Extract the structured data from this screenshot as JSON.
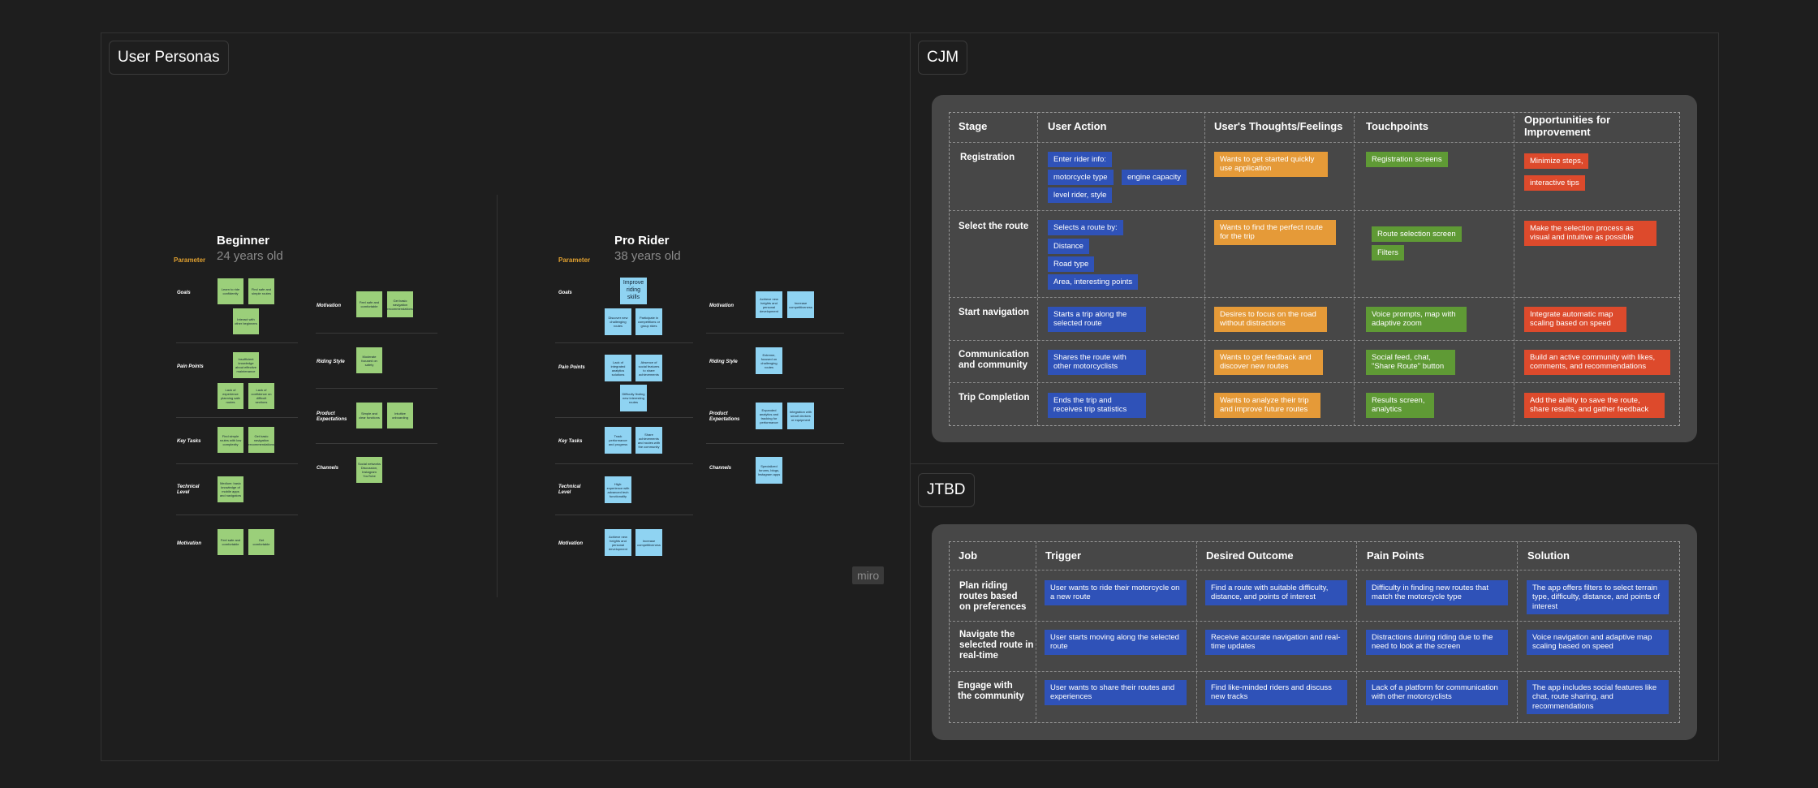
{
  "frames": {
    "personas": "User Personas",
    "cjm": "CJM",
    "jtbd": "JTBD"
  },
  "watermark": "miro",
  "personas": {
    "beginner": {
      "title": "Beginner",
      "age": "24 years old",
      "param": "Parameter",
      "rows": [
        "Goals",
        "Pain Points",
        "Key Tasks",
        "Technical Level",
        "Motivation"
      ],
      "right_rows": [
        "Motivation",
        "Riding Style",
        "Product Expectations",
        "Channels"
      ],
      "goals": [
        "Learn to ride confidently",
        "Find safe and simple routes",
        "Interact with other beginners"
      ],
      "pain": [
        "Insufficient knowledge about effective maintenance",
        "Lack of experience planning safe routes",
        "Lack of confidence on difficult sections"
      ],
      "tasks": [
        "Find simple routes with low complexity",
        "Get basic navigation recommendations"
      ],
      "tech": [
        "Medium: basic knowledge of mobile apps and navigators"
      ],
      "motiv": [
        "Feel safe and comfortable",
        "Get comfortable"
      ],
      "r_motiv": [
        "Feel safe and comfortable",
        "Get basic navigation recommendations"
      ],
      "r_style": [
        "Moderate focused on safety"
      ],
      "r_expect": [
        "Simple and clear functions",
        "Intuitive onboarding"
      ],
      "r_channels": [
        "Social networks Discussion, Instagram YouTube"
      ]
    },
    "pro": {
      "title": "Pro Rider",
      "age": "38 years old",
      "param": "Parameter",
      "rows": [
        "Goals",
        "Pain Points",
        "Key Tasks",
        "Technical Level",
        "Motivation"
      ],
      "right_rows": [
        "Motivation",
        "Riding Style",
        "Product Expectations",
        "Channels"
      ],
      "goals": [
        "Improve riding skills",
        "Discover new challenging routes",
        "Participate in competitions or group rides"
      ],
      "pain": [
        "Lack of integrated analytics solutions",
        "Absence of social features to share achievements",
        "Difficulty finding new interesting routes"
      ],
      "tasks": [
        "Track performance and progress",
        "Share achievements and routes with the community"
      ],
      "tech": [
        "High: experience with advanced tech functionality"
      ],
      "motiv": [
        "Achieve new heights and personal development",
        "Increase competitiveness"
      ],
      "r_motiv": [
        "Achieve new heights and personal development",
        "Increase competitiveness"
      ],
      "r_style": [
        "Extreme, focused on challenging routes"
      ],
      "r_expect": [
        "Expanded analytics and tracking for performance",
        "Integration with smart devices or equipment"
      ],
      "r_channels": [
        "Specialized forums, blogs, Instagram apps"
      ]
    }
  },
  "cjm": {
    "headers": [
      "Stage",
      "User Action",
      "User's Thoughts/Feelings",
      "Touchpoints",
      "Opportunities for Improvement"
    ],
    "rows": [
      {
        "stage": "Registration",
        "actions": [
          "Enter rider info:",
          "motorcycle type",
          "engine capacity",
          "level rider, style"
        ],
        "thoughts": [
          "Wants to get started quickly use application"
        ],
        "touch": [
          "Registration screens"
        ],
        "opps": [
          "Minimize steps,",
          "interactive tips"
        ]
      },
      {
        "stage": "Select the route",
        "actions": [
          "Selects a route by:",
          "Distance",
          "Road type",
          "Area, interesting points"
        ],
        "thoughts": [
          "Wants to find the perfect route for the trip"
        ],
        "touch": [
          "Route selection screen",
          "Filters"
        ],
        "opps": [
          "Make the selection process as visual and intuitive as possible"
        ]
      },
      {
        "stage": "Start navigation",
        "actions": [
          "Starts a trip along the selected route"
        ],
        "thoughts": [
          "Desires to focus on the road without distractions"
        ],
        "touch": [
          "Voice prompts, map with adaptive zoom"
        ],
        "opps": [
          "Integrate automatic map scaling based on speed"
        ]
      },
      {
        "stage": "Communication and community",
        "actions": [
          "Shares the route with other motorcyclists"
        ],
        "thoughts": [
          "Wants to get feedback and discover new routes"
        ],
        "touch": [
          "Social feed, chat, \"Share Route\" button"
        ],
        "opps": [
          "Build an active community with likes, comments, and recommendations"
        ]
      },
      {
        "stage": "Trip Completion",
        "actions": [
          "Ends the trip and receives trip statistics"
        ],
        "thoughts": [
          "Wants to analyze their trip and improve future routes"
        ],
        "touch": [
          "Results screen, analytics"
        ],
        "opps": [
          "Add the ability to save the route, share results, and gather feedback"
        ]
      }
    ]
  },
  "jtbd": {
    "headers": [
      "Job",
      "Trigger",
      "Desired Outcome",
      "Pain Points",
      "Solution"
    ],
    "rows": [
      {
        "job": "Plan riding routes based on preferences",
        "trigger": "User wants to ride their motorcycle on a new route",
        "outcome": "Find a route with suitable difficulty, distance, and points of interest",
        "pain": "Difficulty in finding new routes that match the motorcycle type",
        "solution": "The app offers filters to select terrain type, difficulty, distance, and points of interest"
      },
      {
        "job": "Navigate the selected route in real-time",
        "trigger": "User starts moving along the selected route",
        "outcome": "Receive accurate navigation and real-time updates",
        "pain": "Distractions during riding due to the need to look at the screen",
        "solution": "Voice navigation and adaptive map scaling based on speed"
      },
      {
        "job": "Engage with the community",
        "trigger": "User wants to share their routes and experiences",
        "outcome": "Find like-minded riders and discuss new tracks",
        "pain": "Lack of a platform for communication with other motorcyclists",
        "solution": "The app includes social features like chat, route sharing, and recommendations"
      }
    ]
  }
}
